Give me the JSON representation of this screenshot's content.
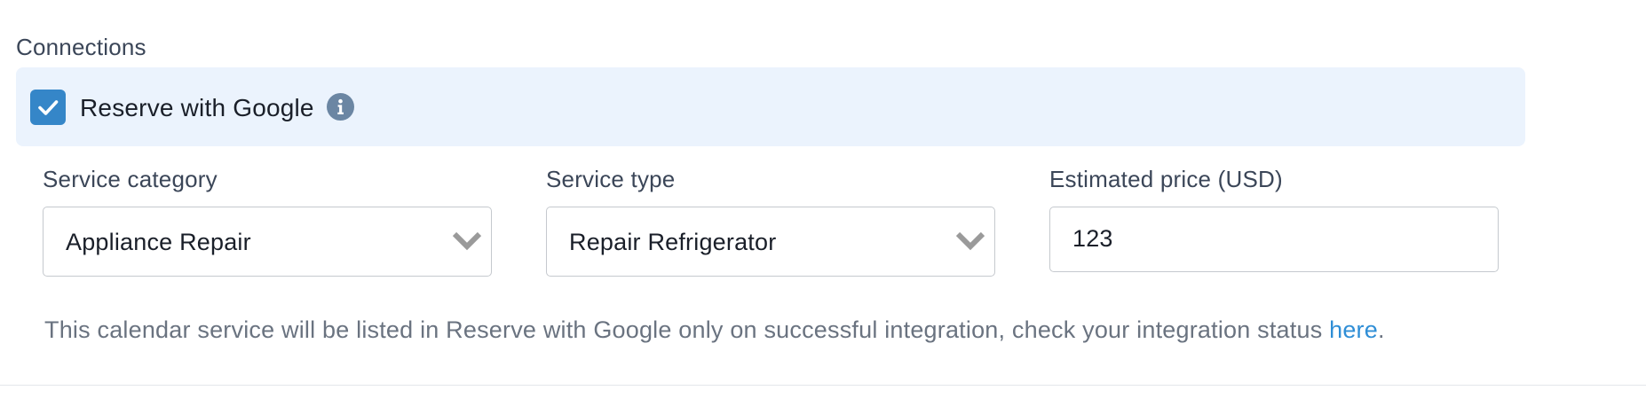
{
  "connections": {
    "title": "Connections",
    "reserve_with_google": {
      "label": "Reserve with Google",
      "checked": true,
      "info_icon": "info-icon"
    }
  },
  "fields": {
    "service_category": {
      "label": "Service category",
      "value": "Appliance Repair",
      "icon": "chevron-down-icon"
    },
    "service_type": {
      "label": "Service type",
      "value": "Repair Refrigerator",
      "icon": "chevron-down-icon"
    },
    "estimated_price": {
      "label": "Estimated price (USD)",
      "value": "123"
    }
  },
  "helper": {
    "text": "This calendar service will be listed in Reserve with Google only on successful integration, check your integration status ",
    "link": "here",
    "suffix": "."
  },
  "colors": {
    "accent": "#3586c8",
    "row_background": "#ebf3fd",
    "link": "#2f8ed6",
    "info_icon": "#6b86a3"
  }
}
